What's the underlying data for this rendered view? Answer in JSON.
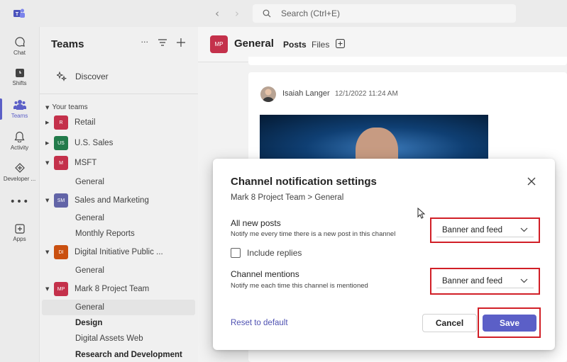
{
  "topbar": {
    "search_placeholder": "Search (Ctrl+E)"
  },
  "rail": {
    "items": [
      {
        "label": "Chat",
        "icon": "chat-icon"
      },
      {
        "label": "Shifts",
        "icon": "shifts-icon"
      },
      {
        "label": "Teams",
        "icon": "teams-icon",
        "active": true
      },
      {
        "label": "Activity",
        "icon": "bell-icon"
      },
      {
        "label": "Developer ...",
        "icon": "developer-portal-icon"
      },
      {
        "label": "Apps",
        "icon": "apps-icon"
      }
    ]
  },
  "panel": {
    "title": "Teams",
    "discover": "Discover",
    "your_teams": "Your teams",
    "teams": [
      {
        "abbr": "R",
        "name": "Retail",
        "color": "#c4314b"
      },
      {
        "abbr": "US",
        "name": "U.S. Sales",
        "color": "#237b4b"
      },
      {
        "abbr": "M",
        "name": "MSFT",
        "color": "#c4314b",
        "channels": [
          "General"
        ]
      },
      {
        "abbr": "SM",
        "name": "Sales and Marketing",
        "color": "#6264a7",
        "channels": [
          "General",
          "Monthly Reports"
        ]
      },
      {
        "abbr": "DI",
        "name": "Digital Initiative Public ...",
        "color": "#ca5010",
        "channels": [
          "General"
        ]
      },
      {
        "abbr": "MP",
        "name": "Mark 8 Project Team",
        "color": "#c4314b",
        "channels": [
          "General",
          "Design",
          "Digital Assets Web",
          "Research and Development"
        ]
      }
    ]
  },
  "header": {
    "avatar": "MP",
    "channel": "General",
    "tabs": [
      "Posts",
      "Files"
    ]
  },
  "post": {
    "author": "Isaiah Langer",
    "time": "12/1/2022 11:24 AM"
  },
  "dialog": {
    "title": "Channel notification settings",
    "breadcrumb": "Mark 8 Project Team > General",
    "all_posts_label": "All new posts",
    "all_posts_desc": "Notify me every time there is a new post in this channel",
    "all_posts_value": "Banner and feed",
    "include_replies": "Include replies",
    "mentions_label": "Channel mentions",
    "mentions_desc": "Notify me each time this channel is mentioned",
    "mentions_value": "Banner and feed",
    "reset": "Reset to default",
    "cancel": "Cancel",
    "save": "Save"
  },
  "colors": {
    "accent": "#5b5fc7",
    "highlight": "#d11f27"
  }
}
